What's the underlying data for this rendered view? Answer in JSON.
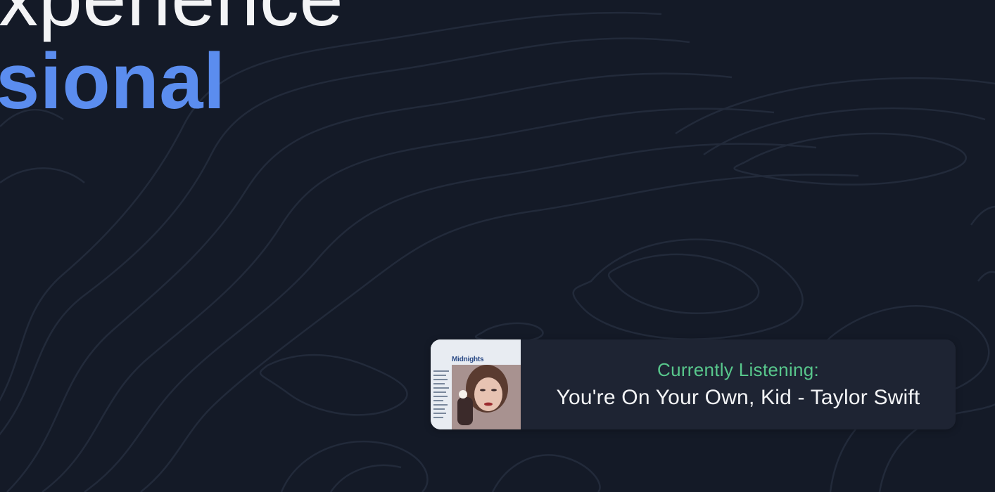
{
  "hero": {
    "line1": "xperience",
    "line2": "sional"
  },
  "now_playing": {
    "label": "Currently Listening:",
    "track": "You're On Your Own, Kid - Taylor Swift",
    "album_art": {
      "wordmark": "Midnights",
      "icon": "album-cover-image"
    }
  },
  "colors": {
    "background": "#141a27",
    "accent_blue": "#5b8def",
    "listening_green": "#58c78c",
    "card": "#1e2433",
    "text": "#f3f4f6"
  }
}
